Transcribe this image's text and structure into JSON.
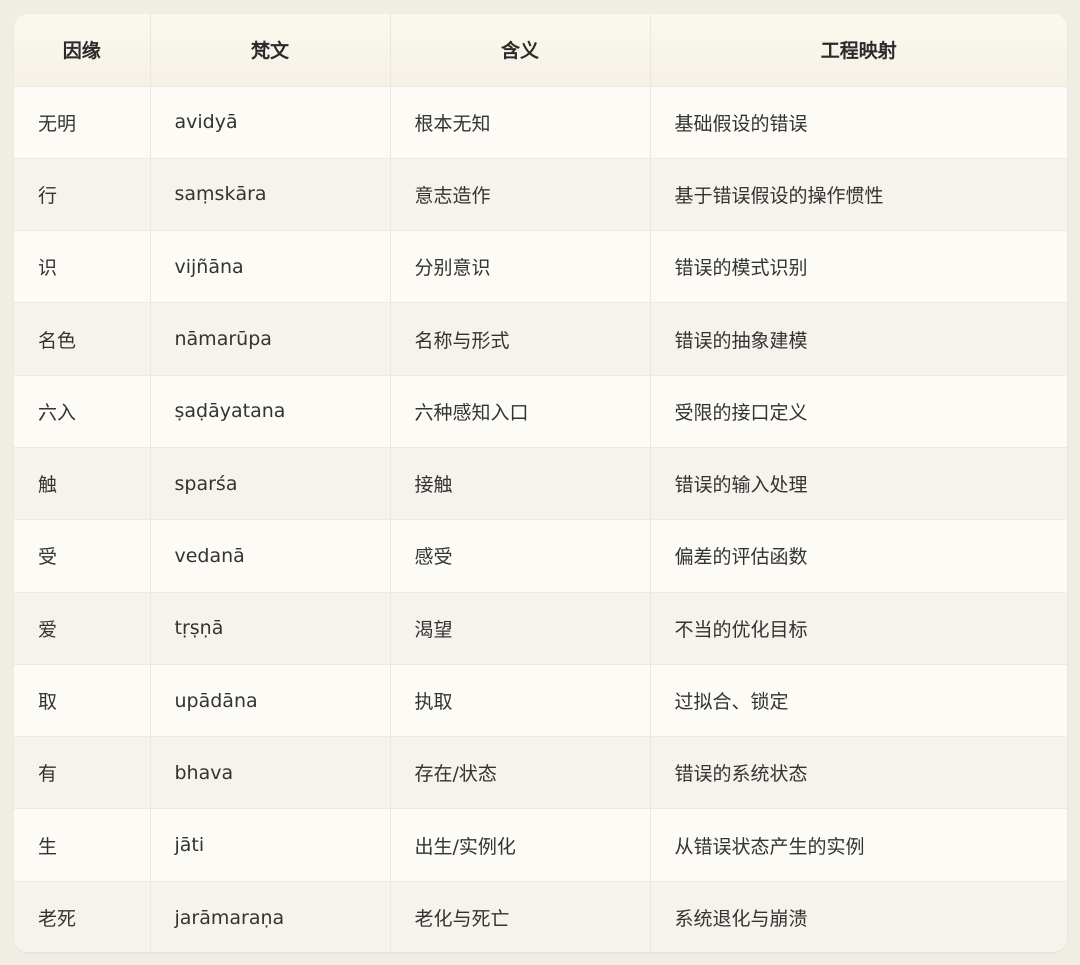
{
  "headers": [
    "因缘",
    "梵文",
    "含义",
    "工程映射"
  ],
  "rows": [
    [
      "无明",
      "avidyā",
      "根本无知",
      "基础假设的错误"
    ],
    [
      "行",
      "saṃskāra",
      "意志造作",
      "基于错误假设的操作惯性"
    ],
    [
      "识",
      "vijñāna",
      "分别意识",
      "错误的模式识别"
    ],
    [
      "名色",
      "nāmarūpa",
      "名称与形式",
      "错误的抽象建模"
    ],
    [
      "六入",
      "ṣaḍāyatana",
      "六种感知入口",
      "受限的接口定义"
    ],
    [
      "触",
      "sparśa",
      "接触",
      "错误的输入处理"
    ],
    [
      "受",
      "vedanā",
      "感受",
      "偏差的评估函数"
    ],
    [
      "爱",
      "tṛṣṇā",
      "渴望",
      "不当的优化目标"
    ],
    [
      "取",
      "upādāna",
      "执取",
      "过拟合、锁定"
    ],
    [
      "有",
      "bhava",
      "存在/状态",
      "错误的系统状态"
    ],
    [
      "生",
      "jāti",
      "出生/实例化",
      "从错误状态产生的实例"
    ],
    [
      "老死",
      "jarāmaraṇa",
      "老化与死亡",
      "系统退化与崩溃"
    ]
  ]
}
